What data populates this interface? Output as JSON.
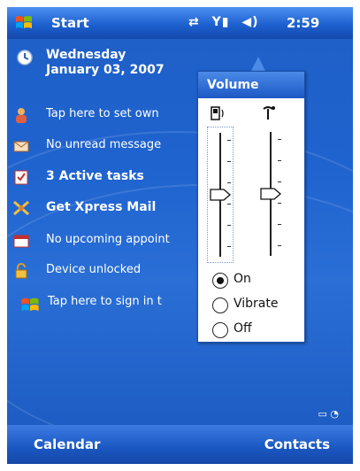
{
  "titlebar": {
    "start_label": "Start",
    "clock": "2:59",
    "status_icons": [
      "sync-icon",
      "signal-icon",
      "speaker-icon"
    ]
  },
  "today": {
    "day": "Wednesday",
    "date": "January 03, 2007",
    "owner": "Tap here to set own",
    "messages": "No unread message",
    "tasks": "3 Active tasks",
    "mail": "Get Xpress Mail",
    "appointments": "No upcoming appoint",
    "lock": "Device unlocked",
    "messenger": "Tap here to sign in t"
  },
  "volume": {
    "title": "Volume",
    "system_level": 0.5,
    "ringer_level": 0.5,
    "options": [
      "On",
      "Vibrate",
      "Off"
    ],
    "selected": "On"
  },
  "softkeys": {
    "left": "Calendar",
    "right": "Contacts"
  }
}
